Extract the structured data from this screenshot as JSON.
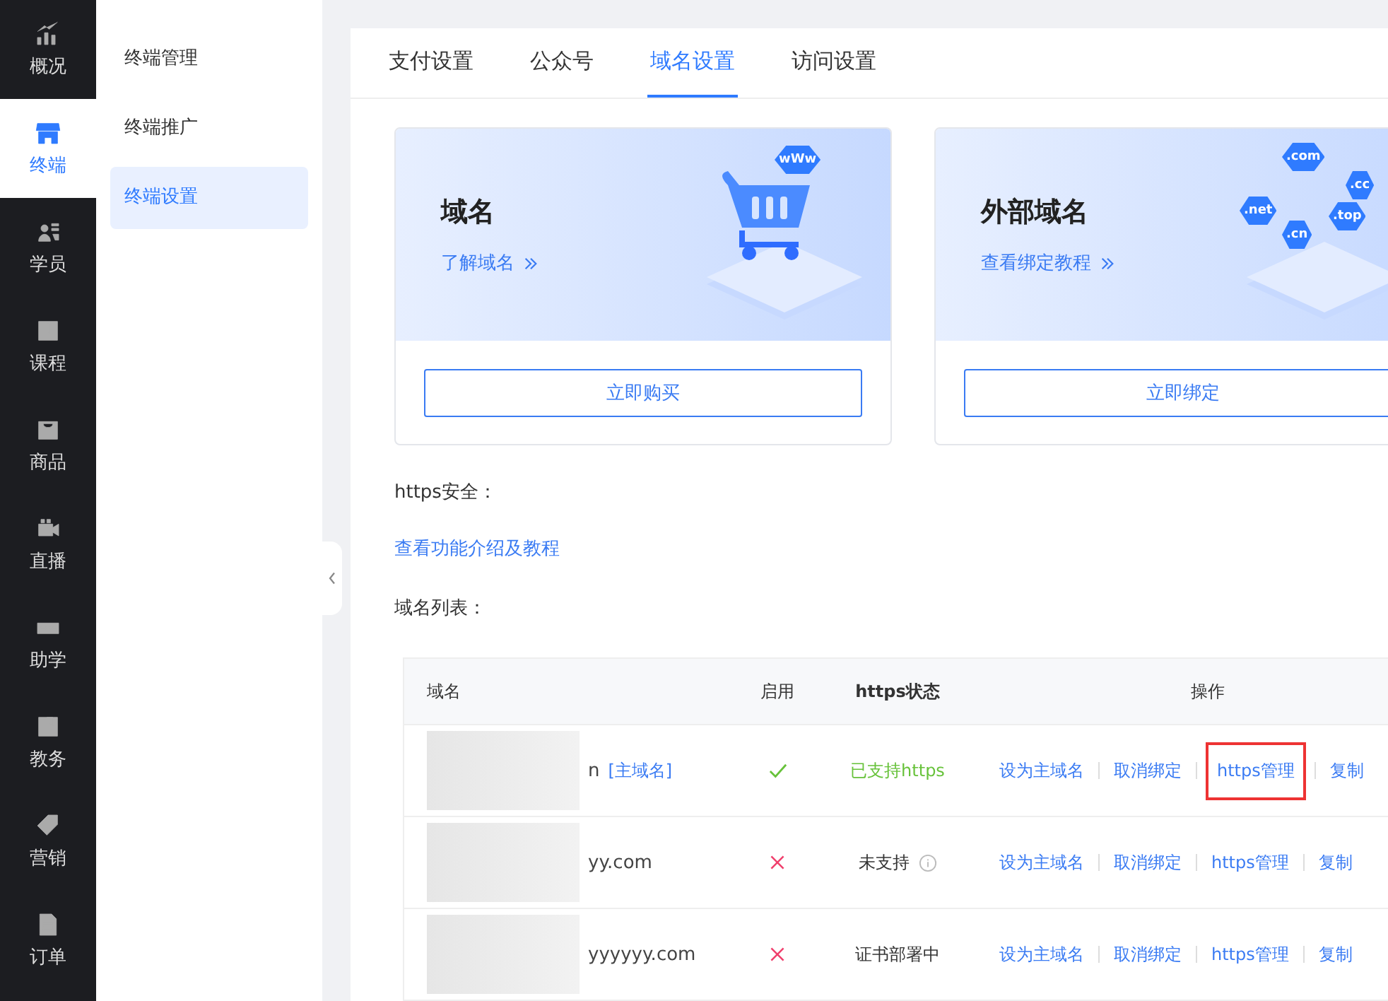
{
  "nav": [
    {
      "label": "概况",
      "selected": false
    },
    {
      "label": "终端",
      "selected": true
    },
    {
      "label": "学员",
      "selected": false
    },
    {
      "label": "课程",
      "selected": false
    },
    {
      "label": "商品",
      "selected": false
    },
    {
      "label": "直播",
      "selected": false
    },
    {
      "label": "助学",
      "selected": false
    },
    {
      "label": "教务",
      "selected": false
    },
    {
      "label": "营销",
      "selected": false
    },
    {
      "label": "订单",
      "selected": false
    }
  ],
  "subnav": [
    {
      "label": "终端管理",
      "selected": false
    },
    {
      "label": "终端推广",
      "selected": false
    },
    {
      "label": "终端设置",
      "selected": true
    }
  ],
  "tabs": [
    {
      "label": "支付设置",
      "selected": false
    },
    {
      "label": "公众号",
      "selected": false
    },
    {
      "label": "域名设置",
      "selected": true
    },
    {
      "label": "访问设置",
      "selected": false
    }
  ],
  "cards": [
    {
      "kind": "cart",
      "title": "域名",
      "link": "了解域名",
      "badges": [
        "wWw"
      ],
      "button": "立即购买"
    },
    {
      "kind": "domains",
      "title": "外部域名",
      "link": "查看绑定教程",
      "badges": [
        ".com",
        ".cc",
        ".net",
        ".top",
        ".cn"
      ],
      "button": "立即绑定"
    }
  ],
  "https_label": "https安全：",
  "https_link": "查看功能介绍及教程",
  "list_label": "域名列表：",
  "table": {
    "columns": [
      "域名",
      "启用",
      "https状态",
      "操作"
    ],
    "rows": [
      {
        "domain": "n",
        "tag": "[主域名]",
        "enabled": true,
        "status": "已支持https",
        "supported": true,
        "info": false,
        "actions": [
          {
            "label": "设为主域名",
            "highlighted": false
          },
          {
            "label": "取消绑定",
            "highlighted": false
          },
          {
            "label": "https管理",
            "highlighted": true
          },
          {
            "label": "复制",
            "highlighted": false
          }
        ]
      },
      {
        "domain": "yy.com",
        "enabled": false,
        "status": "未支持",
        "supported": false,
        "info": true,
        "actions": [
          {
            "label": "设为主域名",
            "highlighted": false
          },
          {
            "label": "取消绑定",
            "highlighted": false
          },
          {
            "label": "https管理",
            "highlighted": false
          },
          {
            "label": "复制",
            "highlighted": false
          }
        ]
      },
      {
        "domain": "yyyyyy.com",
        "enabled": false,
        "status": "证书部署中",
        "supported": false,
        "info": false,
        "actions": [
          {
            "label": "设为主域名",
            "highlighted": false
          },
          {
            "label": "取消绑定",
            "highlighted": false
          },
          {
            "label": "https管理",
            "highlighted": false
          },
          {
            "label": "复制",
            "highlighted": false
          }
        ]
      }
    ]
  }
}
